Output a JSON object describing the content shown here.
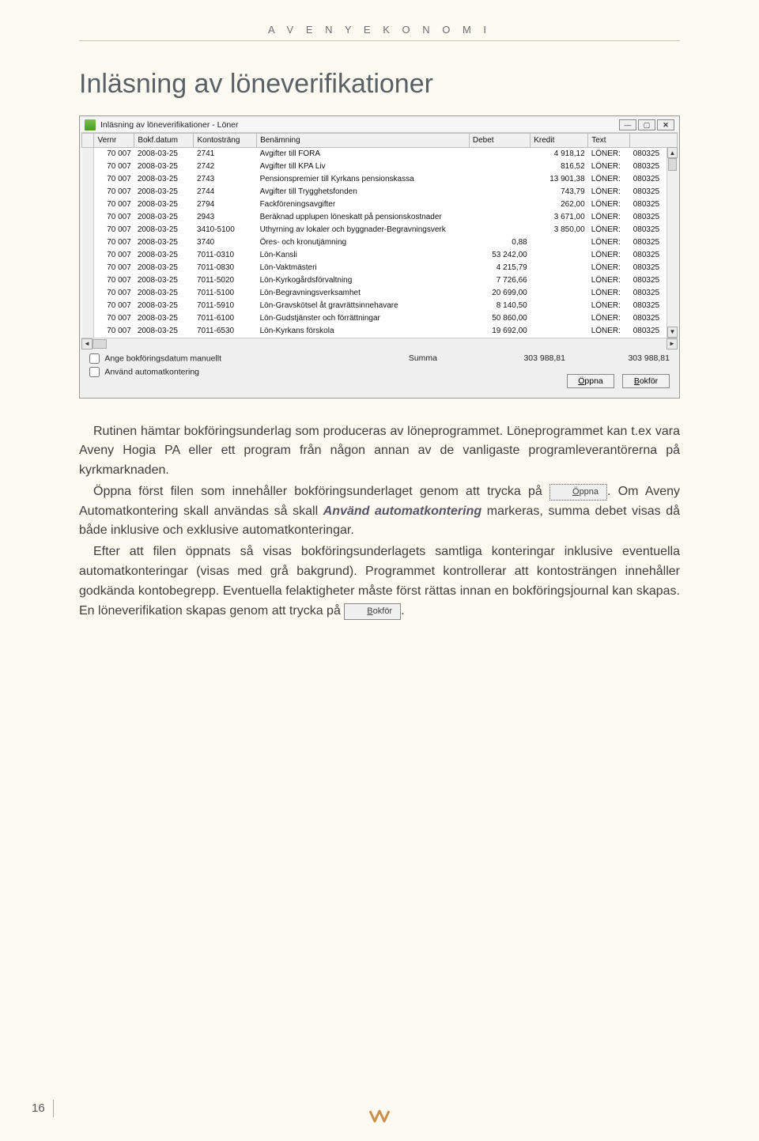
{
  "header": {
    "brand": "A V E N Y   E K O N O M I"
  },
  "title": "Inläsning av löneverifikationer",
  "window": {
    "title": "Inläsning av löneverifikationer - Löner",
    "columns": [
      "Vernr",
      "Bokf.datum",
      "Kontosträng",
      "Benämning",
      "Debet",
      "Kredit",
      "Text",
      ""
    ],
    "rows": [
      {
        "vernr": "70 007",
        "datum": "2008-03-25",
        "konto": "2741",
        "ben": "Avgifter till FORA",
        "debet": "",
        "kredit": "4 918,12",
        "text": "LÖNER:",
        "textv": "080325"
      },
      {
        "vernr": "70 007",
        "datum": "2008-03-25",
        "konto": "2742",
        "ben": "Avgifter till KPA Liv",
        "debet": "",
        "kredit": "816,52",
        "text": "LÖNER:",
        "textv": "080325"
      },
      {
        "vernr": "70 007",
        "datum": "2008-03-25",
        "konto": "2743",
        "ben": "Pensionspremier till Kyrkans pensionskassa",
        "debet": "",
        "kredit": "13 901,38",
        "text": "LÖNER:",
        "textv": "080325"
      },
      {
        "vernr": "70 007",
        "datum": "2008-03-25",
        "konto": "2744",
        "ben": "Avgifter till Trygghetsfonden",
        "debet": "",
        "kredit": "743,79",
        "text": "LÖNER:",
        "textv": "080325"
      },
      {
        "vernr": "70 007",
        "datum": "2008-03-25",
        "konto": "2794",
        "ben": "Fackföreningsavgifter",
        "debet": "",
        "kredit": "262,00",
        "text": "LÖNER:",
        "textv": "080325"
      },
      {
        "vernr": "70 007",
        "datum": "2008-03-25",
        "konto": "2943",
        "ben": "Beräknad upplupen löneskatt på pensionskostnader",
        "debet": "",
        "kredit": "3 671,00",
        "text": "LÖNER:",
        "textv": "080325"
      },
      {
        "vernr": "70 007",
        "datum": "2008-03-25",
        "konto": "3410-5100",
        "ben": "Uthyrning av lokaler och byggnader-Begravningsverk",
        "debet": "",
        "kredit": "3 850,00",
        "text": "LÖNER:",
        "textv": "080325"
      },
      {
        "vernr": "70 007",
        "datum": "2008-03-25",
        "konto": "3740",
        "ben": "Öres- och kronutjämning",
        "debet": "0,88",
        "kredit": "",
        "text": "LÖNER:",
        "textv": "080325"
      },
      {
        "vernr": "70 007",
        "datum": "2008-03-25",
        "konto": "7011-0310",
        "ben": "Lön-Kansli",
        "debet": "53 242,00",
        "kredit": "",
        "text": "LÖNER:",
        "textv": "080325"
      },
      {
        "vernr": "70 007",
        "datum": "2008-03-25",
        "konto": "7011-0830",
        "ben": "Lön-Vaktmästeri",
        "debet": "4 215,79",
        "kredit": "",
        "text": "LÖNER:",
        "textv": "080325"
      },
      {
        "vernr": "70 007",
        "datum": "2008-03-25",
        "konto": "7011-5020",
        "ben": "Lön-Kyrkogårdsförvaltning",
        "debet": "7 726,66",
        "kredit": "",
        "text": "LÖNER:",
        "textv": "080325"
      },
      {
        "vernr": "70 007",
        "datum": "2008-03-25",
        "konto": "7011-5100",
        "ben": "Lön-Begravningsverksamhet",
        "debet": "20 699,00",
        "kredit": "",
        "text": "LÖNER:",
        "textv": "080325"
      },
      {
        "vernr": "70 007",
        "datum": "2008-03-25",
        "konto": "7011-5910",
        "ben": "Lön-Gravskötsel åt gravrättsinnehavare",
        "debet": "8 140,50",
        "kredit": "",
        "text": "LÖNER:",
        "textv": "080325"
      },
      {
        "vernr": "70 007",
        "datum": "2008-03-25",
        "konto": "7011-6100",
        "ben": "Lön-Gudstjänster och förrättningar",
        "debet": "50 860,00",
        "kredit": "",
        "text": "LÖNER:",
        "textv": "080325"
      },
      {
        "vernr": "70 007",
        "datum": "2008-03-25",
        "konto": "7011-6530",
        "ben": "Lön-Kyrkans förskola",
        "debet": "19 692,00",
        "kredit": "",
        "text": "LÖNER:",
        "textv": "080325"
      }
    ],
    "manual_date_label": "Ange bokföringsdatum manuellt",
    "auto_kontering_label": "Använd automatkontering",
    "summa_label": "Summa",
    "summa_debet": "303 988,81",
    "summa_kredit": "303 988,81",
    "open_btn": "Öppna",
    "post_btn": "Bokför"
  },
  "body": {
    "p1a": "Rutinen hämtar bokföringsunderlag som produceras av löneprogrammet. Löneprogrammet kan t.ex vara Aveny Hogia PA eller ett program från någon annan av de vanligaste programleverantörerna på kyrkmarknaden.",
    "p2a": "Öppna först filen som innehåller bokföringsunderlaget genom att trycka på ",
    "p2btn": "Öppna",
    "p2b": ". Om Aveny Automatkontering skall användas så skall ",
    "p2ref": "Använd automatkontering",
    "p2c": " markeras, summa debet visas då både inklusive och exklusive automatkonteringar.",
    "p3": "Efter att filen öppnats så visas bokföringsunderlagets samtliga konteringar inklusive eventuella automatkonteringar (visas med grå bakgrund). Programmet kontrollerar att kontosträngen innehåller godkända kontobegrepp. Eventuella felaktigheter måste först rättas innan en bokföringsjournal kan skapas. En löneverifikation skapas genom att trycka på ",
    "p3btn": "Bokför",
    "p3b": "."
  },
  "page_number": "16"
}
